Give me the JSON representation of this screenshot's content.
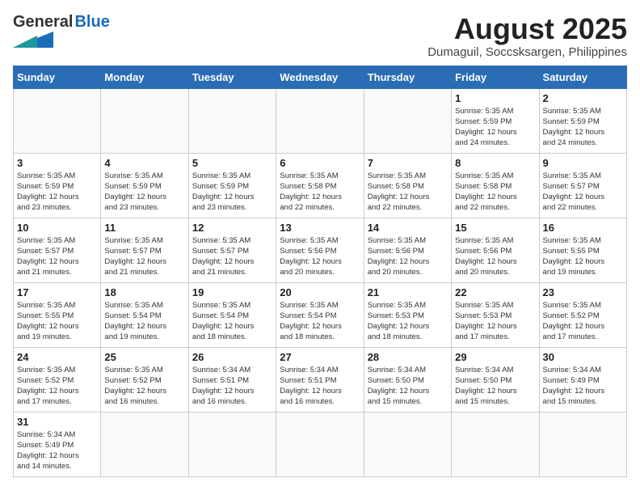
{
  "header": {
    "logo_general": "General",
    "logo_blue": "Blue",
    "month_year": "August 2025",
    "location": "Dumaguil, Soccsksargen, Philippines"
  },
  "days_of_week": [
    "Sunday",
    "Monday",
    "Tuesday",
    "Wednesday",
    "Thursday",
    "Friday",
    "Saturday"
  ],
  "weeks": [
    [
      {
        "day": "",
        "info": ""
      },
      {
        "day": "",
        "info": ""
      },
      {
        "day": "",
        "info": ""
      },
      {
        "day": "",
        "info": ""
      },
      {
        "day": "",
        "info": ""
      },
      {
        "day": "1",
        "info": "Sunrise: 5:35 AM\nSunset: 5:59 PM\nDaylight: 12 hours\nand 24 minutes."
      },
      {
        "day": "2",
        "info": "Sunrise: 5:35 AM\nSunset: 5:59 PM\nDaylight: 12 hours\nand 24 minutes."
      }
    ],
    [
      {
        "day": "3",
        "info": "Sunrise: 5:35 AM\nSunset: 5:59 PM\nDaylight: 12 hours\nand 23 minutes."
      },
      {
        "day": "4",
        "info": "Sunrise: 5:35 AM\nSunset: 5:59 PM\nDaylight: 12 hours\nand 23 minutes."
      },
      {
        "day": "5",
        "info": "Sunrise: 5:35 AM\nSunset: 5:59 PM\nDaylight: 12 hours\nand 23 minutes."
      },
      {
        "day": "6",
        "info": "Sunrise: 5:35 AM\nSunset: 5:58 PM\nDaylight: 12 hours\nand 22 minutes."
      },
      {
        "day": "7",
        "info": "Sunrise: 5:35 AM\nSunset: 5:58 PM\nDaylight: 12 hours\nand 22 minutes."
      },
      {
        "day": "8",
        "info": "Sunrise: 5:35 AM\nSunset: 5:58 PM\nDaylight: 12 hours\nand 22 minutes."
      },
      {
        "day": "9",
        "info": "Sunrise: 5:35 AM\nSunset: 5:57 PM\nDaylight: 12 hours\nand 22 minutes."
      }
    ],
    [
      {
        "day": "10",
        "info": "Sunrise: 5:35 AM\nSunset: 5:57 PM\nDaylight: 12 hours\nand 21 minutes."
      },
      {
        "day": "11",
        "info": "Sunrise: 5:35 AM\nSunset: 5:57 PM\nDaylight: 12 hours\nand 21 minutes."
      },
      {
        "day": "12",
        "info": "Sunrise: 5:35 AM\nSunset: 5:57 PM\nDaylight: 12 hours\nand 21 minutes."
      },
      {
        "day": "13",
        "info": "Sunrise: 5:35 AM\nSunset: 5:56 PM\nDaylight: 12 hours\nand 20 minutes."
      },
      {
        "day": "14",
        "info": "Sunrise: 5:35 AM\nSunset: 5:56 PM\nDaylight: 12 hours\nand 20 minutes."
      },
      {
        "day": "15",
        "info": "Sunrise: 5:35 AM\nSunset: 5:56 PM\nDaylight: 12 hours\nand 20 minutes."
      },
      {
        "day": "16",
        "info": "Sunrise: 5:35 AM\nSunset: 5:55 PM\nDaylight: 12 hours\nand 19 minutes."
      }
    ],
    [
      {
        "day": "17",
        "info": "Sunrise: 5:35 AM\nSunset: 5:55 PM\nDaylight: 12 hours\nand 19 minutes."
      },
      {
        "day": "18",
        "info": "Sunrise: 5:35 AM\nSunset: 5:54 PM\nDaylight: 12 hours\nand 19 minutes."
      },
      {
        "day": "19",
        "info": "Sunrise: 5:35 AM\nSunset: 5:54 PM\nDaylight: 12 hours\nand 18 minutes."
      },
      {
        "day": "20",
        "info": "Sunrise: 5:35 AM\nSunset: 5:54 PM\nDaylight: 12 hours\nand 18 minutes."
      },
      {
        "day": "21",
        "info": "Sunrise: 5:35 AM\nSunset: 5:53 PM\nDaylight: 12 hours\nand 18 minutes."
      },
      {
        "day": "22",
        "info": "Sunrise: 5:35 AM\nSunset: 5:53 PM\nDaylight: 12 hours\nand 17 minutes."
      },
      {
        "day": "23",
        "info": "Sunrise: 5:35 AM\nSunset: 5:52 PM\nDaylight: 12 hours\nand 17 minutes."
      }
    ],
    [
      {
        "day": "24",
        "info": "Sunrise: 5:35 AM\nSunset: 5:52 PM\nDaylight: 12 hours\nand 17 minutes."
      },
      {
        "day": "25",
        "info": "Sunrise: 5:35 AM\nSunset: 5:52 PM\nDaylight: 12 hours\nand 16 minutes."
      },
      {
        "day": "26",
        "info": "Sunrise: 5:34 AM\nSunset: 5:51 PM\nDaylight: 12 hours\nand 16 minutes."
      },
      {
        "day": "27",
        "info": "Sunrise: 5:34 AM\nSunset: 5:51 PM\nDaylight: 12 hours\nand 16 minutes."
      },
      {
        "day": "28",
        "info": "Sunrise: 5:34 AM\nSunset: 5:50 PM\nDaylight: 12 hours\nand 15 minutes."
      },
      {
        "day": "29",
        "info": "Sunrise: 5:34 AM\nSunset: 5:50 PM\nDaylight: 12 hours\nand 15 minutes."
      },
      {
        "day": "30",
        "info": "Sunrise: 5:34 AM\nSunset: 5:49 PM\nDaylight: 12 hours\nand 15 minutes."
      }
    ],
    [
      {
        "day": "31",
        "info": "Sunrise: 5:34 AM\nSunset: 5:49 PM\nDaylight: 12 hours\nand 14 minutes."
      },
      {
        "day": "",
        "info": ""
      },
      {
        "day": "",
        "info": ""
      },
      {
        "day": "",
        "info": ""
      },
      {
        "day": "",
        "info": ""
      },
      {
        "day": "",
        "info": ""
      },
      {
        "day": "",
        "info": ""
      }
    ]
  ]
}
